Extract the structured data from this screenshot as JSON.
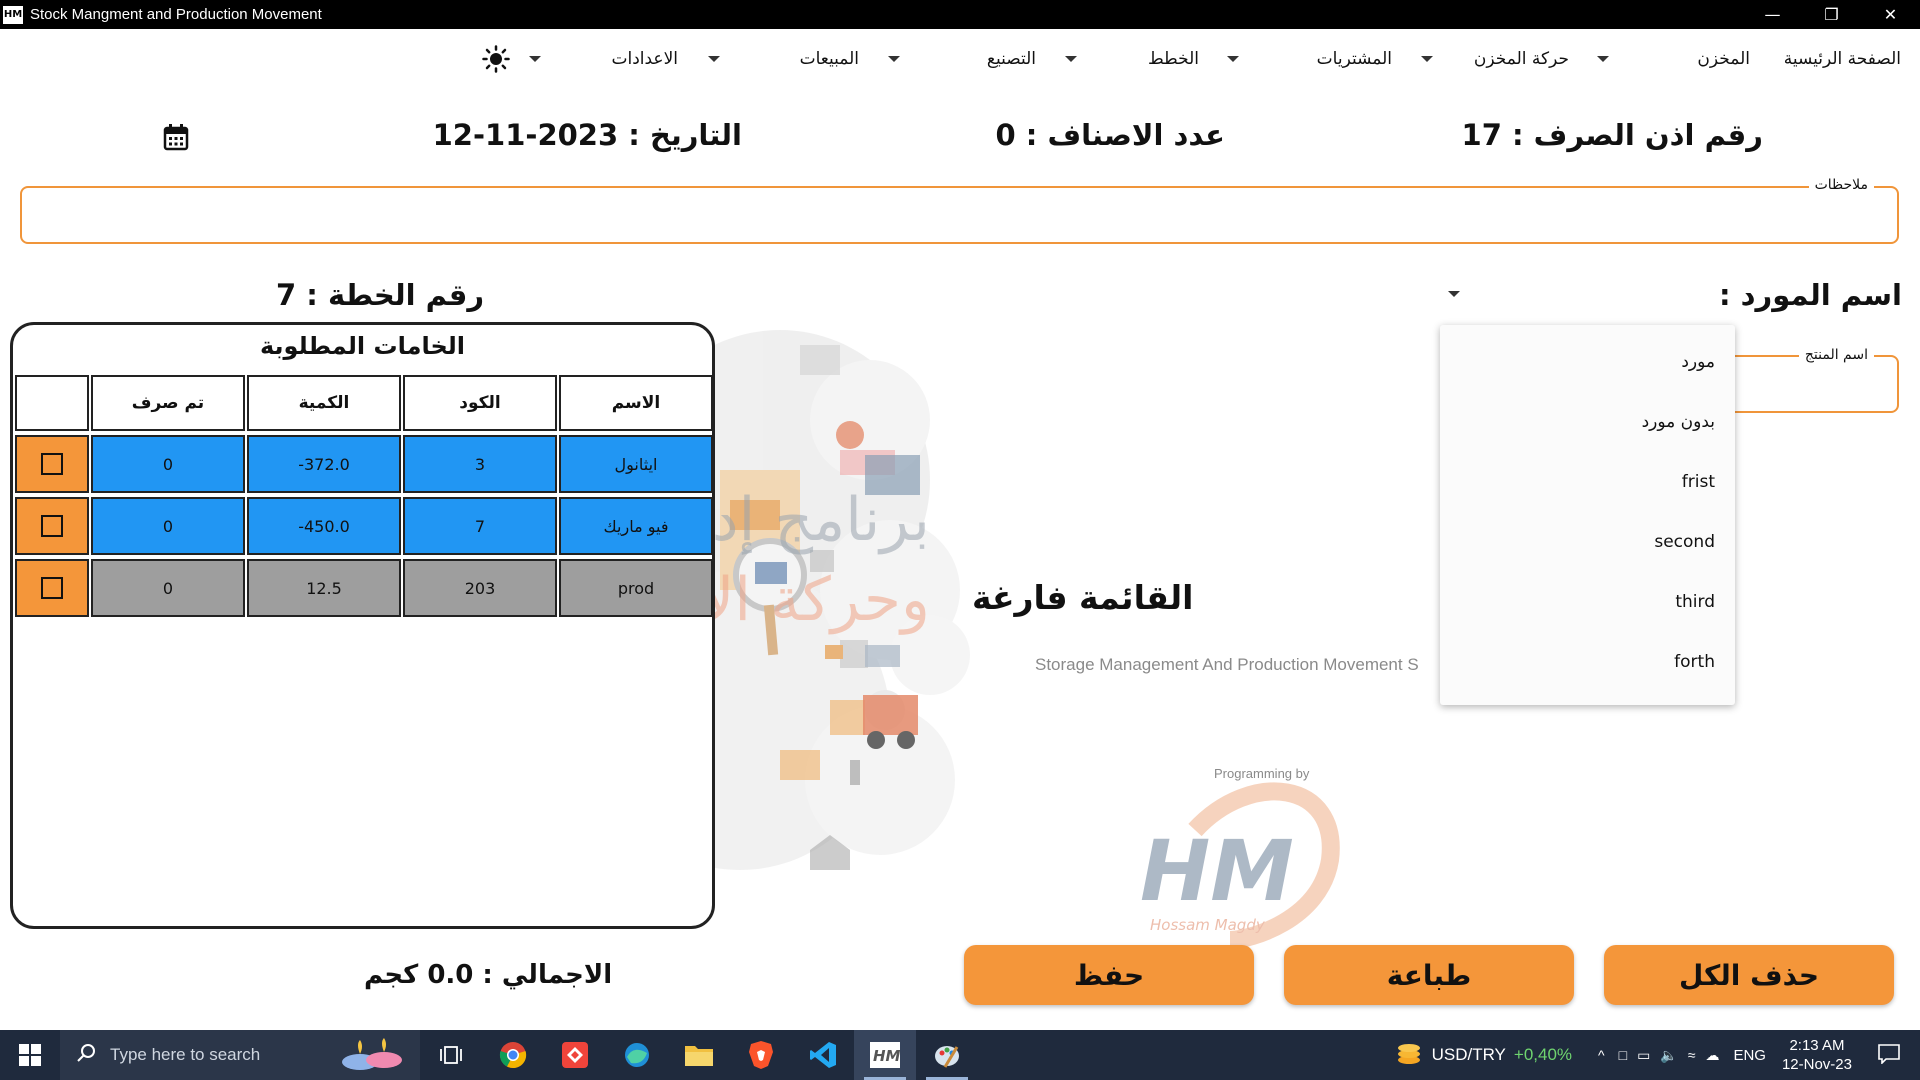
{
  "window": {
    "title": "Stock Mangment and Production Movement",
    "app_icon_text": "HM",
    "controls": [
      "minimize",
      "restore",
      "close"
    ]
  },
  "menu": {
    "home": "الصفحة الرئيسية",
    "store": "المخزن",
    "store_movement": "حركة المخزن",
    "purchases": "المشتريات",
    "plans": "الخطط",
    "manufacturing": "التصنيع",
    "sales": "المبيعات",
    "settings": "الاعدادات",
    "theme_icon": "sun-icon"
  },
  "header": {
    "voucher_number": "رقم اذن الصرف : 17",
    "items_count": "عدد الاصناف : 0",
    "date": "التاريخ : 2023-11-12"
  },
  "notes": {
    "label": "ملاحظات",
    "value": ""
  },
  "supplier": {
    "label": "اسم المورد :",
    "product_label": "اسم المنتج",
    "options": [
      "مورد",
      "بدون مورد",
      "frist",
      "second",
      "third",
      "forth"
    ]
  },
  "plan": {
    "label": "رقم الخطة : 7"
  },
  "materials": {
    "title": "الخامات المطلوبة",
    "columns": [
      "الاسم",
      "الكود",
      "الكمية",
      "تم صرف",
      ""
    ],
    "rows": [
      {
        "name": "ايثانول",
        "code": "3",
        "quantity": "-372.0",
        "dispensed": "0",
        "highlight": true
      },
      {
        "name": "فيو ماريك",
        "code": "7",
        "quantity": "-450.0",
        "dispensed": "0",
        "highlight": true
      },
      {
        "name": "prod",
        "code": "203",
        "quantity": "12.5",
        "dispensed": "0",
        "highlight": false
      }
    ]
  },
  "background": {
    "title_ar_1": "برنامج إدارة المخازن",
    "title_ar_2": "وحركة الانتاج",
    "empty_list": "القائمة فارغة",
    "subtitle_en": "Storage Management And Production Movement S",
    "programming_by": "Programming by",
    "logo": "HM",
    "author": "Hossam Magdy"
  },
  "footer": {
    "total": "الاجمالي : 0.0 كجم",
    "delete_all": "حذف الكل",
    "print": "طباعة",
    "save": "حفظ"
  },
  "taskbar": {
    "search_placeholder": "Type here to search",
    "currency": "USD/TRY",
    "currency_change": "+0,40%",
    "lang": "ENG",
    "time": "2:13 AM",
    "date": "12-Nov-23"
  },
  "colors": {
    "accent_orange": "#f4963a",
    "row_blue": "#2196f3",
    "row_gray": "#9e9e9e",
    "taskbar": "#1f2a3d"
  }
}
